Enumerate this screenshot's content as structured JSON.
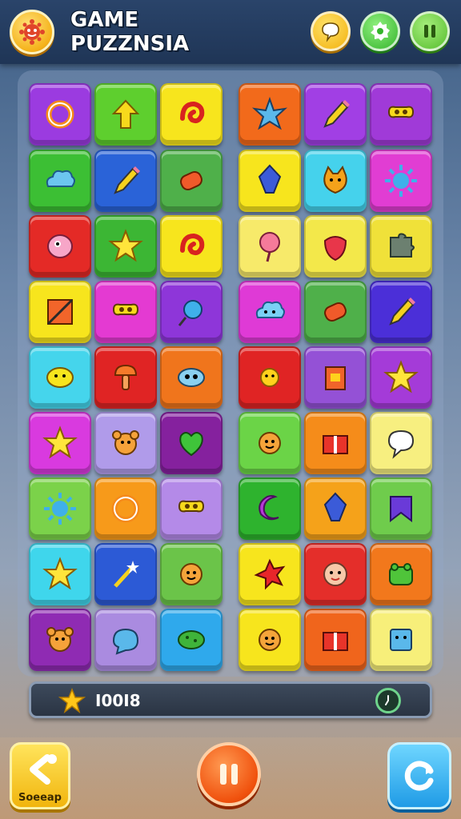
{
  "header": {
    "title_line1": "GAME",
    "title_line2": "PUZZNSIA",
    "logo_icon": "sun-creature-icon",
    "buttons": [
      {
        "name": "chat-button",
        "icon": "speech-bubble-icon"
      },
      {
        "name": "settings-button",
        "icon": "gear-icon"
      },
      {
        "name": "pause-button",
        "icon": "pause-icon"
      }
    ]
  },
  "board": {
    "columns": 6,
    "rows": 9,
    "tiles": [
      [
        {
          "color": "#9b3be0",
          "icon": "ring"
        },
        {
          "color": "#5ecf2e",
          "icon": "arrow-up"
        },
        {
          "color": "#f7e51d",
          "icon": "swirl"
        },
        {
          "color": "#f26a1b",
          "icon": "star-burst"
        },
        {
          "color": "#a13fe4",
          "icon": "pencil"
        },
        {
          "color": "#a03ad8",
          "icon": "bone"
        }
      ],
      [
        {
          "color": "#3cbf34",
          "icon": "cloud"
        },
        {
          "color": "#2a63d8",
          "icon": "pencil"
        },
        {
          "color": "#4fb04a",
          "icon": "candy"
        },
        {
          "color": "#f7e51d",
          "icon": "crystal"
        },
        {
          "color": "#45d2ec",
          "icon": "cat-face"
        },
        {
          "color": "#e13dd3",
          "icon": "sun"
        }
      ],
      [
        {
          "color": "#e42a26",
          "icon": "blob-face"
        },
        {
          "color": "#3cb634",
          "icon": "star"
        },
        {
          "color": "#f7e51d",
          "icon": "swirl"
        },
        {
          "color": "#f7ea6a",
          "icon": "balloon-face"
        },
        {
          "color": "#f3e84a",
          "icon": "strawberry-face"
        },
        {
          "color": "#f0e139",
          "icon": "puzzle-piece"
        }
      ],
      [
        {
          "color": "#f7e51d",
          "icon": "notebook"
        },
        {
          "color": "#e43ad2",
          "icon": "bone"
        },
        {
          "color": "#8e36d9",
          "icon": "lollipop"
        },
        {
          "color": "#df3ad6",
          "icon": "cloud-face"
        },
        {
          "color": "#4fb04a",
          "icon": "candy"
        },
        {
          "color": "#4b2fd8",
          "icon": "pencil"
        }
      ],
      [
        {
          "color": "#45d5ec",
          "icon": "smile-blob"
        },
        {
          "color": "#e02424",
          "icon": "mushroom"
        },
        {
          "color": "#f0751c",
          "icon": "fish-face"
        },
        {
          "color": "#e02424",
          "icon": "sun-face"
        },
        {
          "color": "#9451d6",
          "icon": "box"
        },
        {
          "color": "#a43bd8",
          "icon": "star"
        }
      ],
      [
        {
          "color": "#d93adf",
          "icon": "star"
        },
        {
          "color": "#b09bea",
          "icon": "bear-face"
        },
        {
          "color": "#85219e",
          "icon": "heart"
        },
        {
          "color": "#6bd447",
          "icon": "cookie-face"
        },
        {
          "color": "#f58c1a",
          "icon": "gift-box"
        },
        {
          "color": "#f7ef80",
          "icon": "speech-bubble"
        }
      ],
      [
        {
          "color": "#7bd24a",
          "icon": "sun"
        },
        {
          "color": "#f79a1a",
          "icon": "ring"
        },
        {
          "color": "#b48ae8",
          "icon": "bone"
        },
        {
          "color": "#2eb32e",
          "icon": "moon"
        },
        {
          "color": "#f5a21a",
          "icon": "crystal"
        },
        {
          "color": "#6fcc4c",
          "icon": "flag"
        }
      ],
      [
        {
          "color": "#3fd6ec",
          "icon": "star"
        },
        {
          "color": "#2c5ad6",
          "icon": "magic-wand"
        },
        {
          "color": "#6bc449",
          "icon": "cookie-face"
        },
        {
          "color": "#f7e51d",
          "icon": "splat"
        },
        {
          "color": "#e42e2a",
          "icon": "face"
        },
        {
          "color": "#f2781c",
          "icon": "frog-face"
        }
      ],
      [
        {
          "color": "#8f2bb3",
          "icon": "bear-face"
        },
        {
          "color": "#aa8be0",
          "icon": "speech-drop"
        },
        {
          "color": "#2fa9ec",
          "icon": "pickle"
        },
        {
          "color": "#f7e51d",
          "icon": "cookie-face"
        },
        {
          "color": "#f0651c",
          "icon": "gift-box"
        },
        {
          "color": "#f7ef7a",
          "icon": "square-face"
        }
      ]
    ]
  },
  "score": {
    "icon": "star-icon",
    "value": "I00I8",
    "timer_icon": "clock-icon"
  },
  "footer": {
    "back_label": "Soeeap",
    "back_icon": "back-arrow-icon",
    "pause_icon": "pause-icon",
    "refresh_icon": "refresh-icon"
  }
}
